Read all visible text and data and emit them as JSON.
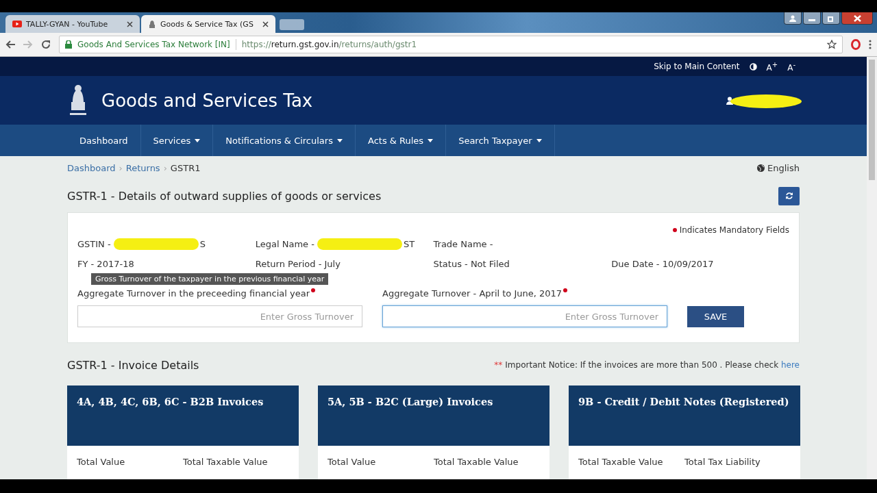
{
  "browser": {
    "tabs": [
      {
        "title": "TALLY-GYAN - YouTube",
        "kind": "youtube",
        "selected": false
      },
      {
        "title": "Goods & Service Tax (GS",
        "kind": "emblem",
        "selected": true
      }
    ],
    "site_identity": "Goods And Services Tax Network [IN]",
    "url_scheme": "https://",
    "url_host": "return.gst.gov.in",
    "url_path": "/returns/auth/gstr1"
  },
  "topbar": {
    "skip_link": "Skip to Main Content",
    "font_larger": "A$^{+}$",
    "font_smaller": "A$^{-}$"
  },
  "header": {
    "title": "Goods and Services Tax"
  },
  "nav": [
    {
      "label": "Dashboard",
      "dropdown": false
    },
    {
      "label": "Services",
      "dropdown": true
    },
    {
      "label": "Notifications & Circulars",
      "dropdown": true
    },
    {
      "label": "Acts & Rules",
      "dropdown": true
    },
    {
      "label": "Search Taxpayer",
      "dropdown": true
    }
  ],
  "breadcrumb": [
    {
      "label": "Dashboard",
      "current": false
    },
    {
      "separator": "›",
      "label": "Returns",
      "current": false
    },
    {
      "separator": "›",
      "label": "GSTR1",
      "current": true
    }
  ],
  "language": "English",
  "page_title": "GSTR-1 - Details of outward supplies of goods or services",
  "mandatory_note": "Indicates Mandatory Fields",
  "details": [
    [
      {
        "text": "GSTIN -",
        "tail": "S",
        "redacted": true
      },
      {
        "text": "Legal Name -",
        "tail": "ST",
        "redacted": true
      },
      {
        "text": "Trade Name -",
        "redacted": false
      }
    ],
    [
      {
        "text": "FY - 2017-18",
        "redacted": false
      },
      {
        "text": "Return Period - July",
        "redacted": false
      },
      {
        "text": "Status - Not Filed",
        "redacted": false
      },
      {
        "text": "Due Date - 10/09/2017",
        "redacted": false
      }
    ]
  ],
  "tooltip": "Gross Turnover of the taxpayer in the previous financial year",
  "fields": [
    {
      "label": "Aggregate Turnover in the preceeding financial year",
      "placeholder": "Enter Gross Turnover",
      "focused": false
    },
    {
      "label": "Aggregate Turnover - April to June, 2017",
      "placeholder": "Enter Gross Turnover",
      "focused": true
    }
  ],
  "save_button": "SAVE",
  "invoice_section": {
    "title": "GSTR-1 - Invoice Details",
    "notice_mark": "**",
    "notice": "Important Notice: If the invoices are more than 500 . Please check",
    "notice_link": "here"
  },
  "cards": [
    {
      "title": "4A, 4B, 4C, 6B, 6C - B2B Invoices",
      "columns": [
        "Total Value",
        "Total Taxable Value"
      ]
    },
    {
      "title": "5A, 5B - B2C (Large) Invoices",
      "columns": [
        "Total Value",
        "Total Taxable Value"
      ]
    },
    {
      "title": "9B - Credit / Debit Notes (Registered)",
      "columns": [
        "Total Taxable Value",
        "Total Tax Liability"
      ]
    }
  ]
}
